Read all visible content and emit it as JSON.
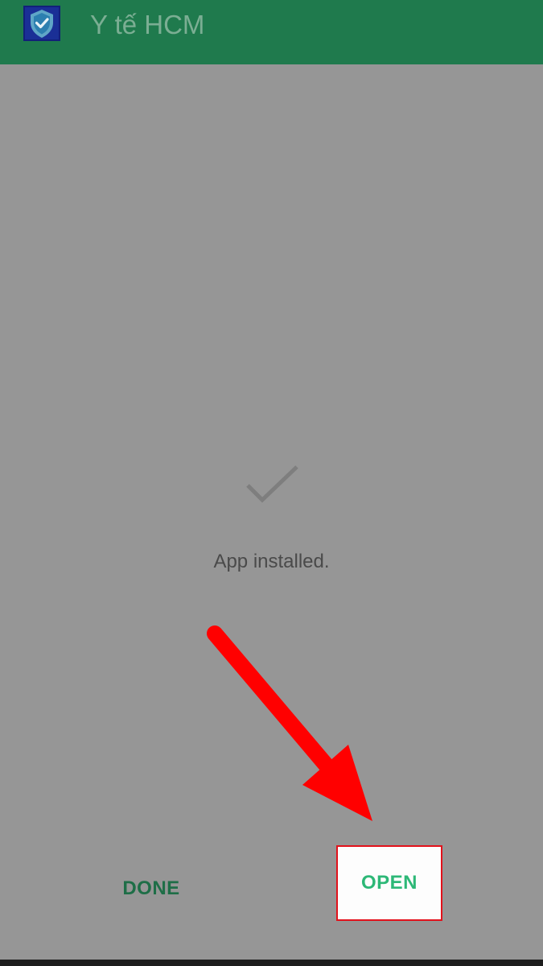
{
  "appbar": {
    "title": "Y tế HCM",
    "icon": "shield-check-icon",
    "background": "#1f7a4d"
  },
  "install_status": {
    "icon": "checkmark-icon",
    "message": "App installed."
  },
  "actions": {
    "done_label": "DONE",
    "open_label": "OPEN"
  },
  "annotation": {
    "icon": "red-arrow-icon",
    "color": "#ff0000",
    "highlight_border_color": "#e2111b"
  },
  "colors": {
    "dim_background": "#969696",
    "done_text": "#1e6e47",
    "open_text": "#2db877"
  }
}
